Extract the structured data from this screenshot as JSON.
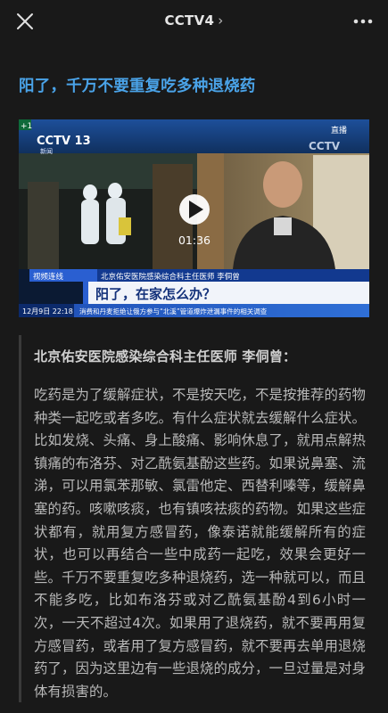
{
  "topbar": {
    "title": "CCTV4",
    "title_chevron": "›",
    "close_icon": "close-icon",
    "more_icon": "more-icon"
  },
  "headline": "阳了，千万不要重复吃多种退烧药",
  "video": {
    "duration": "01:36",
    "channel_logo": "CCTV 13",
    "channel_sub": "新闻",
    "live_label": "直播",
    "corner_label": "+1",
    "lower_third_tag": "视频连线",
    "caption_small": "北京佑安医院感染综合科主任医师 李侗曾",
    "caption_big": "阳了，在家怎么办？",
    "date_time": "12月9日  22:18",
    "ticker": "消费和丹麦拒绝让俄方参与“北溪”管道爆炸泄漏事件的相关调查"
  },
  "quote": {
    "title": "北京佑安医院感染综合科主任医师 李侗曾：",
    "body": "吃药是为了缓解症状，不是按天吃，不是按推荐的药物种类一起吃或者多吃。有什么症状就去缓解什么症状。比如发烧、头痛、身上酸痛、影响休息了，就用点解热镇痛的布洛芬、对乙酰氨基酚这些药。如果说鼻塞、流涕，可以用氯苯那敏、氯雷他定、西替利嗪等，缓解鼻塞的药。咳嗽咳痰，也有镇咳祛痰的药物。如果这些症状都有，就用复方感冒药，像泰诺就能缓解所有的症状，也可以再结合一些中成药一起吃，效果会更好一些。千万不要重复吃多种退烧药，选一种就可以，而且不能多吃，比如布洛芬或对乙酰氨基酚4到6小时一次，一天不超过4次。如果用了退烧药，就不要再用复方感冒药，或者用了复方感冒药，就不要再去单用退烧药了，因为这里边有一些退烧的成分，一旦过量是对身体有损害的。"
  },
  "colors": {
    "background": "#191919",
    "headline": "#4aa3e8",
    "body_text": "#b9b9b9",
    "quote_bar": "#3a3a3a"
  }
}
